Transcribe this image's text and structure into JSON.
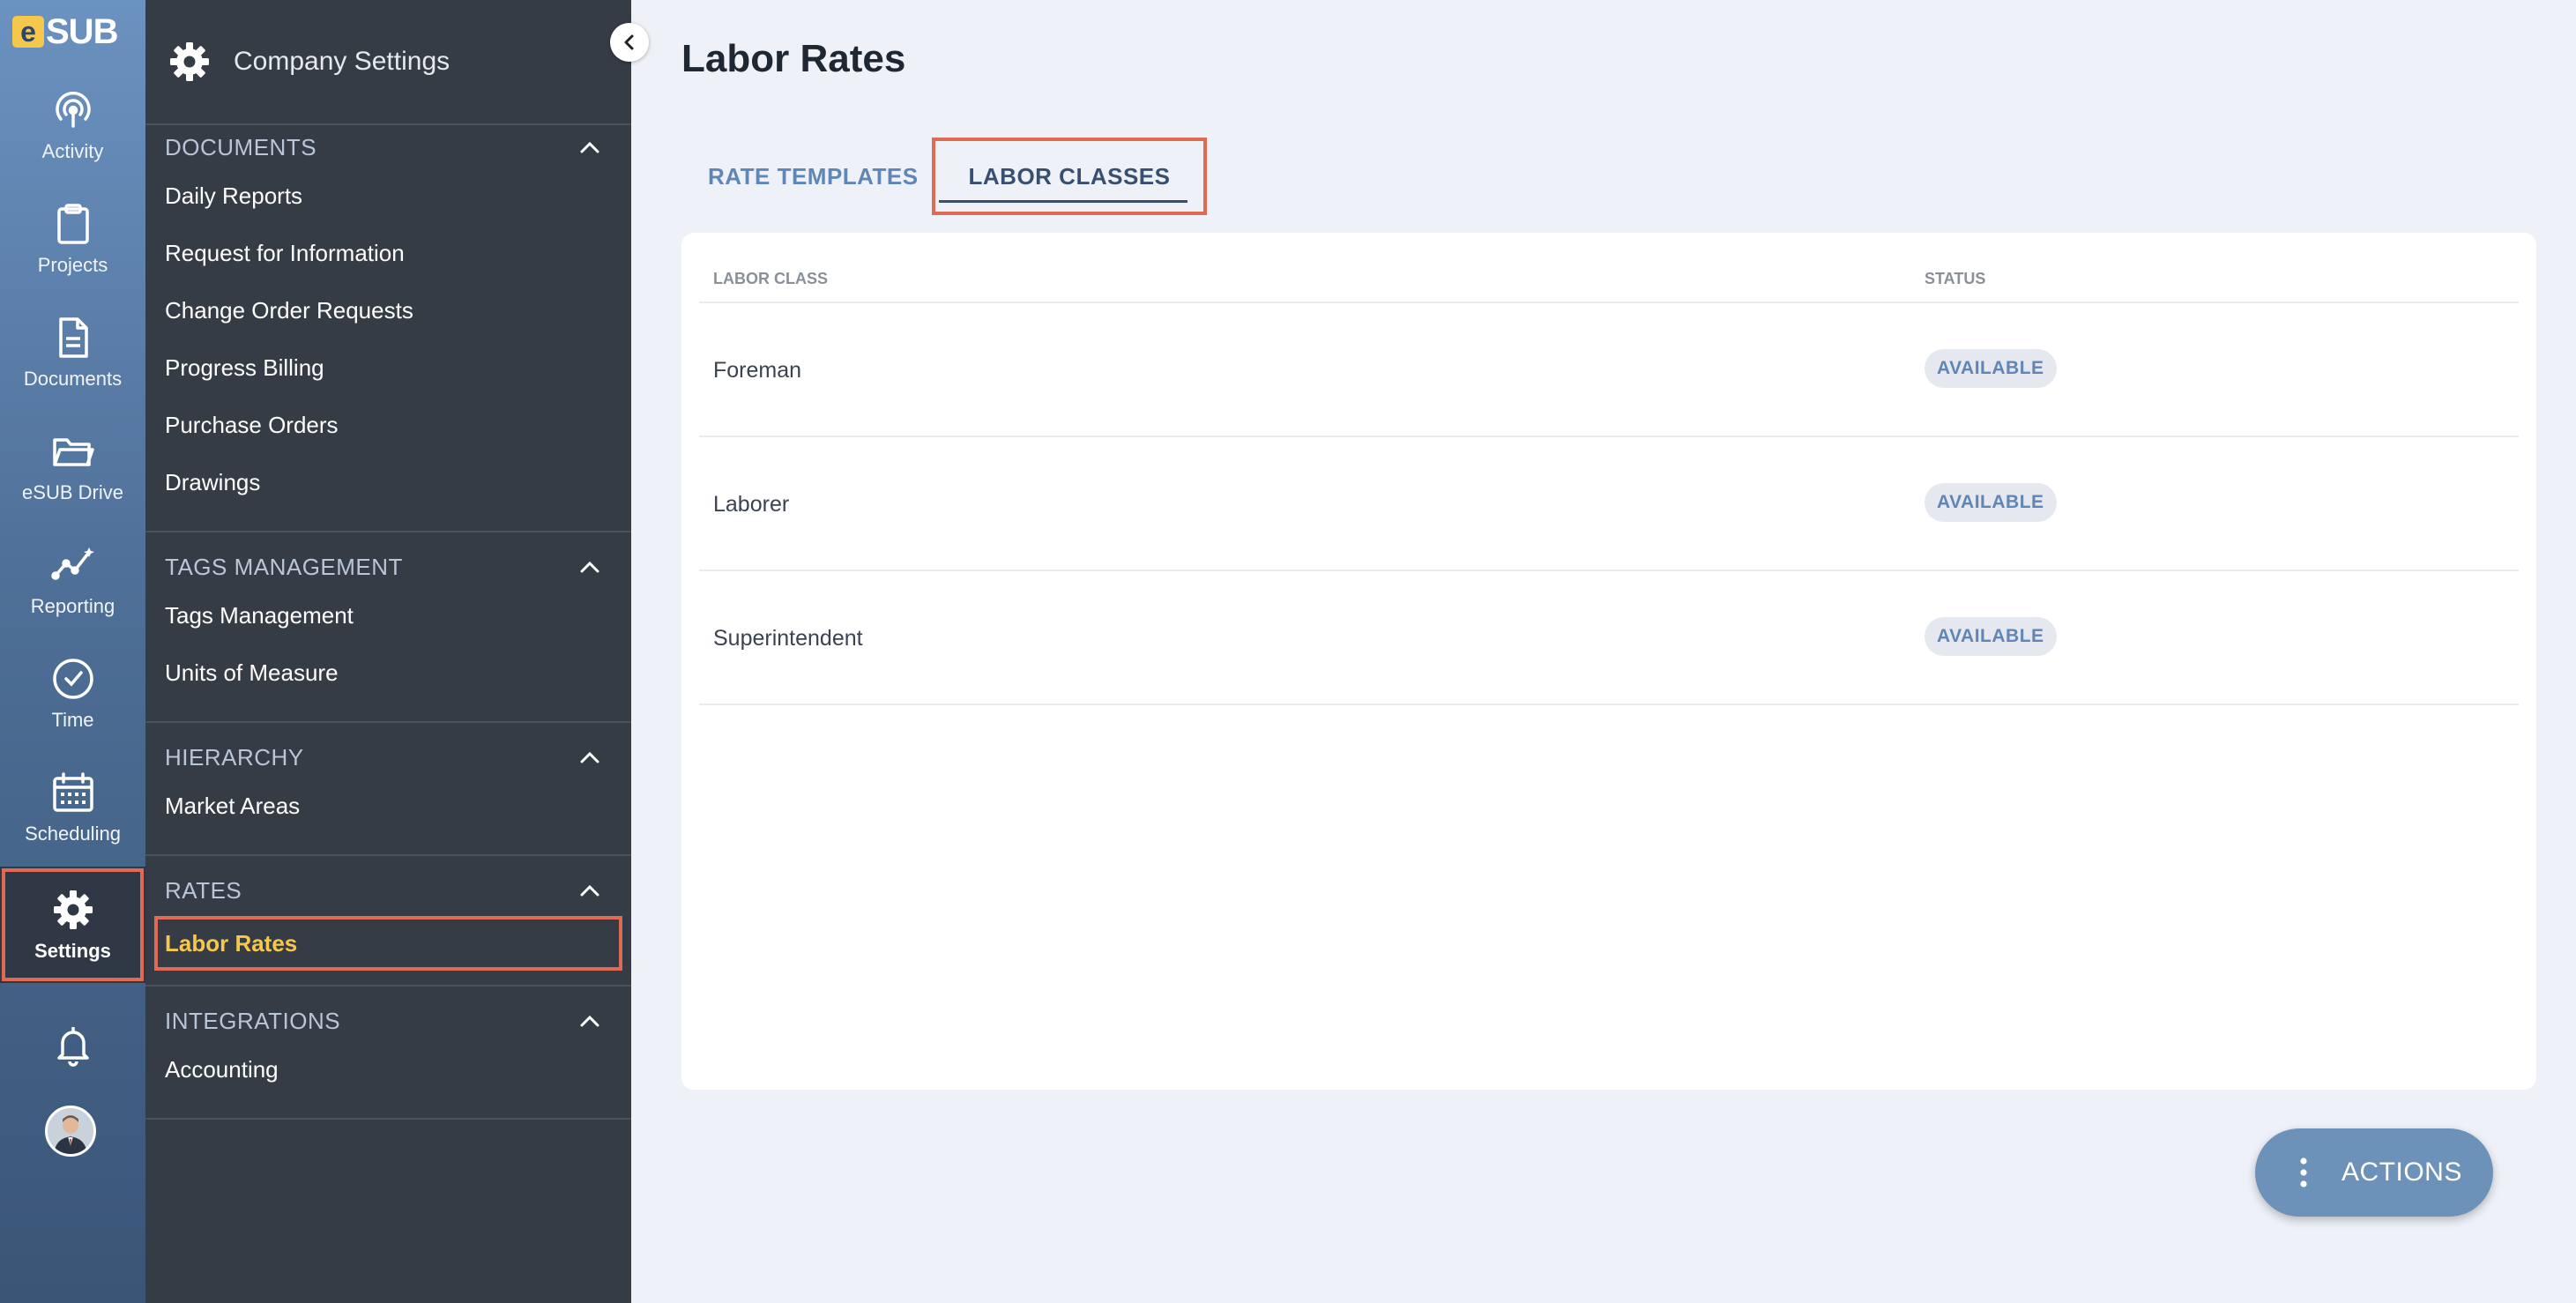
{
  "brand": {
    "logo_letter": "e",
    "logo_rest": "SUB"
  },
  "rail": {
    "items": [
      {
        "label": "Activity",
        "icon": "activity-icon"
      },
      {
        "label": "Projects",
        "icon": "clipboard-icon"
      },
      {
        "label": "Documents",
        "icon": "document-icon"
      },
      {
        "label": "eSUB Drive",
        "icon": "folder-icon"
      },
      {
        "label": "Reporting",
        "icon": "trend-icon"
      },
      {
        "label": "Time",
        "icon": "clock-icon"
      },
      {
        "label": "Scheduling",
        "icon": "calendar-icon"
      },
      {
        "label": "Settings",
        "icon": "gear-icon",
        "active": true
      }
    ]
  },
  "sidebar": {
    "title": "Company Settings",
    "sections": [
      {
        "title": "DOCUMENTS",
        "items": [
          "Daily Reports",
          "Request for Information",
          "Change Order Requests",
          "Progress Billing",
          "Purchase Orders",
          "Drawings"
        ]
      },
      {
        "title": "TAGS MANAGEMENT",
        "items": [
          "Tags Management",
          "Units of Measure"
        ]
      },
      {
        "title": "HIERARCHY",
        "items": [
          "Market Areas"
        ]
      },
      {
        "title": "RATES",
        "items": [
          "Labor Rates"
        ],
        "selected": "Labor Rates"
      },
      {
        "title": "INTEGRATIONS",
        "items": [
          "Accounting"
        ]
      }
    ]
  },
  "main": {
    "title": "Labor Rates",
    "tabs": [
      {
        "label": "RATE TEMPLATES",
        "active": false
      },
      {
        "label": "LABOR CLASSES",
        "active": true
      }
    ],
    "table": {
      "columns": [
        "LABOR CLASS",
        "STATUS"
      ],
      "rows": [
        {
          "name": "Foreman",
          "status": "AVAILABLE"
        },
        {
          "name": "Laborer",
          "status": "AVAILABLE"
        },
        {
          "name": "Superintendent",
          "status": "AVAILABLE"
        }
      ]
    },
    "actions_label": "ACTIONS"
  },
  "colors": {
    "accent": "#f5c84c",
    "highlight": "#e06b55",
    "tab_active": "#38506f",
    "tab_inactive": "#5f86b4",
    "actions_button": "#6d92ba"
  }
}
